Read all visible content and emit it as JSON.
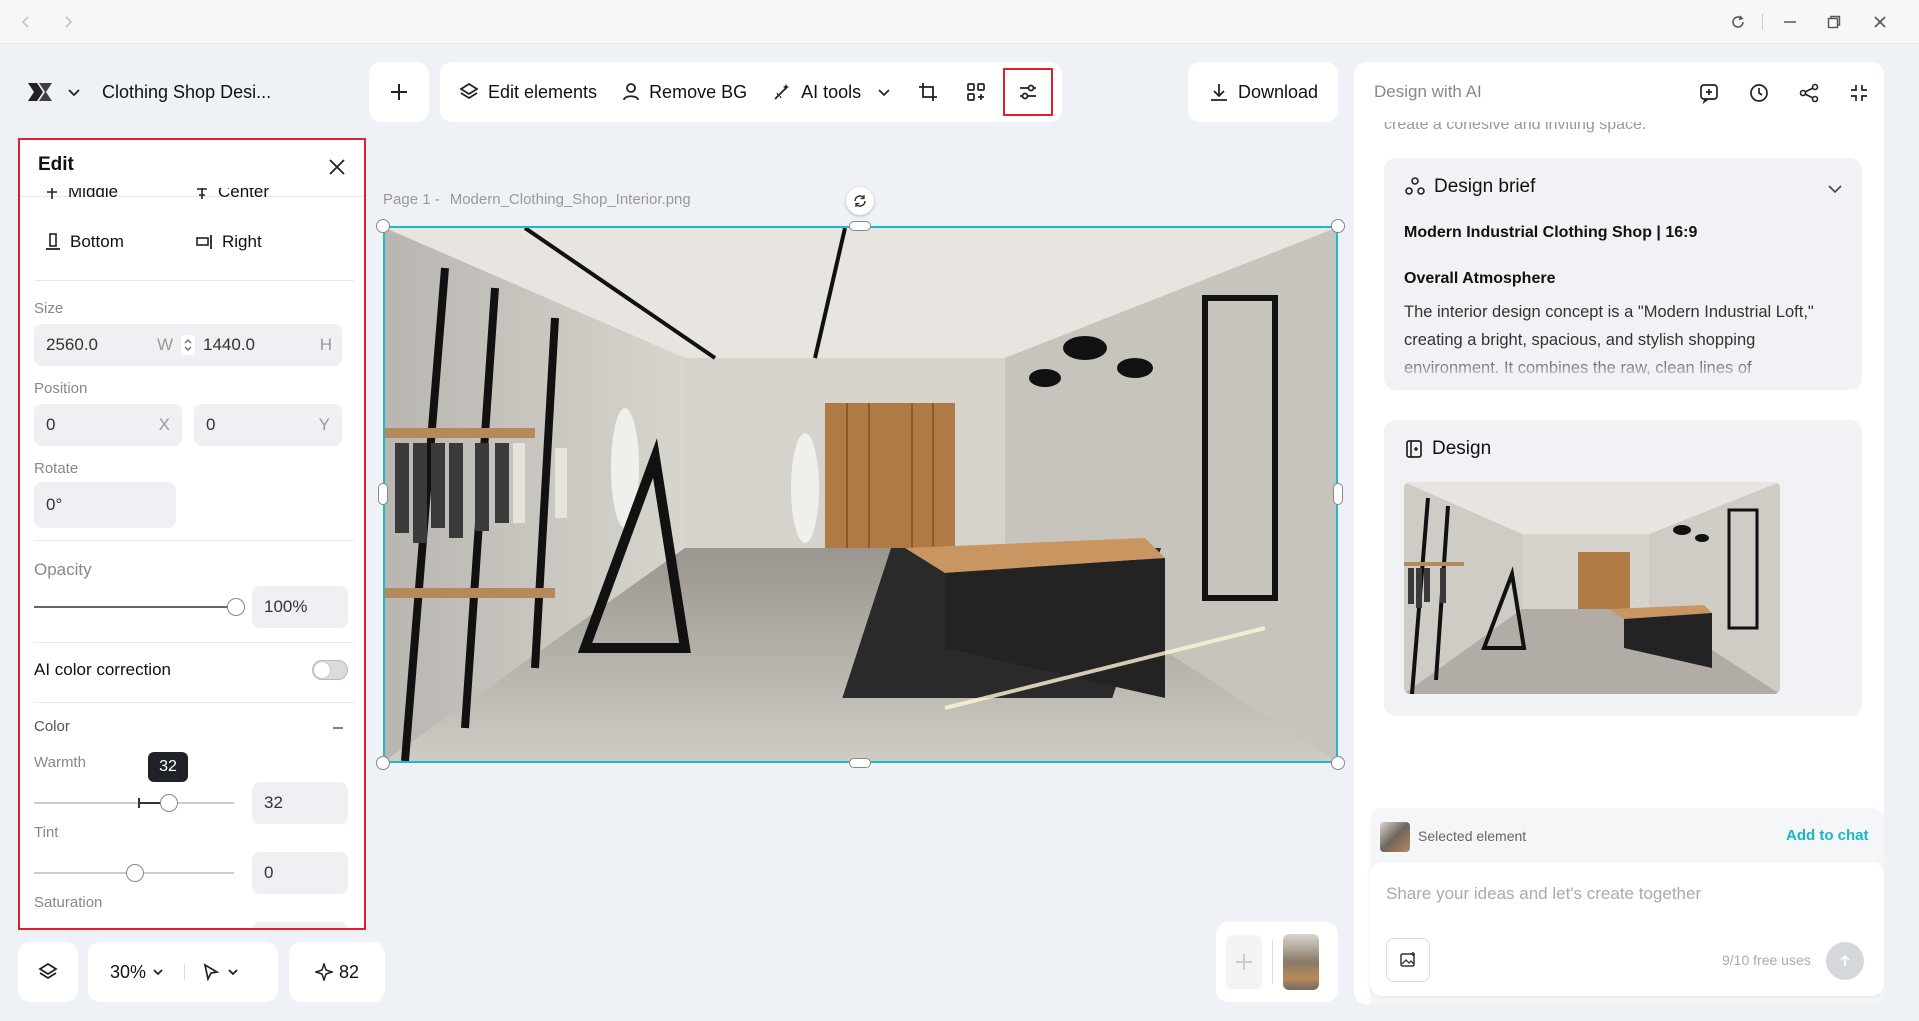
{
  "project": {
    "name": "Clothing Shop Desi..."
  },
  "toolbar": {
    "edit_elements": "Edit elements",
    "remove_bg": "Remove BG",
    "ai_tools": "AI tools",
    "download": "Download"
  },
  "canvas": {
    "page_label": "Page 1 -",
    "file_name": "Modern_Clothing_Shop_Interior.png"
  },
  "edit_panel": {
    "title": "Edit",
    "align": {
      "middle": "Middle",
      "center": "Center",
      "bottom": "Bottom",
      "right": "Right"
    },
    "size": {
      "label": "Size",
      "width": "2560.0",
      "width_suffix": "W",
      "height": "1440.0",
      "height_suffix": "H"
    },
    "position": {
      "label": "Position",
      "x": "0",
      "x_suffix": "X",
      "y": "0",
      "y_suffix": "Y"
    },
    "rotate": {
      "label": "Rotate",
      "value": "0°"
    },
    "opacity": {
      "label": "Opacity",
      "value": "100%",
      "level": 1.0
    },
    "ai_color_correction": {
      "label": "AI color correction",
      "enabled": false
    },
    "color": {
      "label": "Color",
      "warmth": {
        "label": "Warmth",
        "value": "32",
        "tooltip": "32"
      },
      "tint": {
        "label": "Tint",
        "value": "0"
      },
      "saturation": {
        "label": "Saturation"
      }
    }
  },
  "bottom_bar": {
    "zoom": "30%",
    "credits": "82"
  },
  "ai_panel": {
    "title": "Design with AI",
    "faded_text": "create a cohesive and inviting space.",
    "brief": {
      "title": "Design brief",
      "subtitle": "Modern Industrial Clothing Shop | 16:9",
      "section": "Overall Atmosphere",
      "body": "The interior design concept is a \"Modern Industrial Loft,\" creating a bright, spacious, and stylish shopping environment. It combines the raw, clean lines of"
    },
    "design": {
      "title": "Design"
    },
    "selected_element": "Selected element",
    "add_to_chat": "Add to chat",
    "input_placeholder": "Share your ideas and let's create together",
    "free_uses": "9/10 free uses"
  },
  "colors": {
    "accent": "#1fb8d0",
    "highlight": "#e0202a",
    "link": "#18b6c8"
  }
}
